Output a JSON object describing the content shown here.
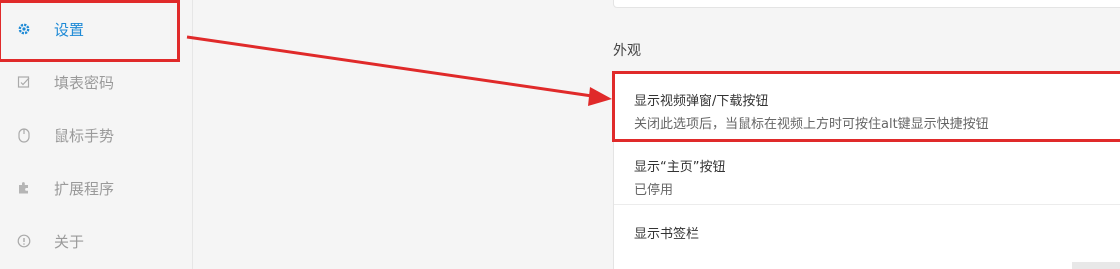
{
  "sidebar": {
    "items": [
      {
        "label": "设置",
        "icon": "gear-icon",
        "active": true
      },
      {
        "label": "填表密码",
        "icon": "form-icon",
        "active": false
      },
      {
        "label": "鼠标手势",
        "icon": "mouse-icon",
        "active": false
      },
      {
        "label": "扩展程序",
        "icon": "puzzle-icon",
        "active": false
      },
      {
        "label": "关于",
        "icon": "info-icon",
        "active": false
      }
    ]
  },
  "main": {
    "section_title": "外观",
    "settings": [
      {
        "title": "显示视频弹窗/下载按钮",
        "subtitle": "关闭此选项后，当鼠标在视频上方时可按住alt键显示快捷按钮"
      },
      {
        "title": "显示“主页”按钮",
        "subtitle": "已停用"
      },
      {
        "title": "显示书签栏",
        "subtitle": ""
      }
    ]
  },
  "colors": {
    "accent": "#1e8ad6",
    "annotation": "#e02a2a"
  }
}
